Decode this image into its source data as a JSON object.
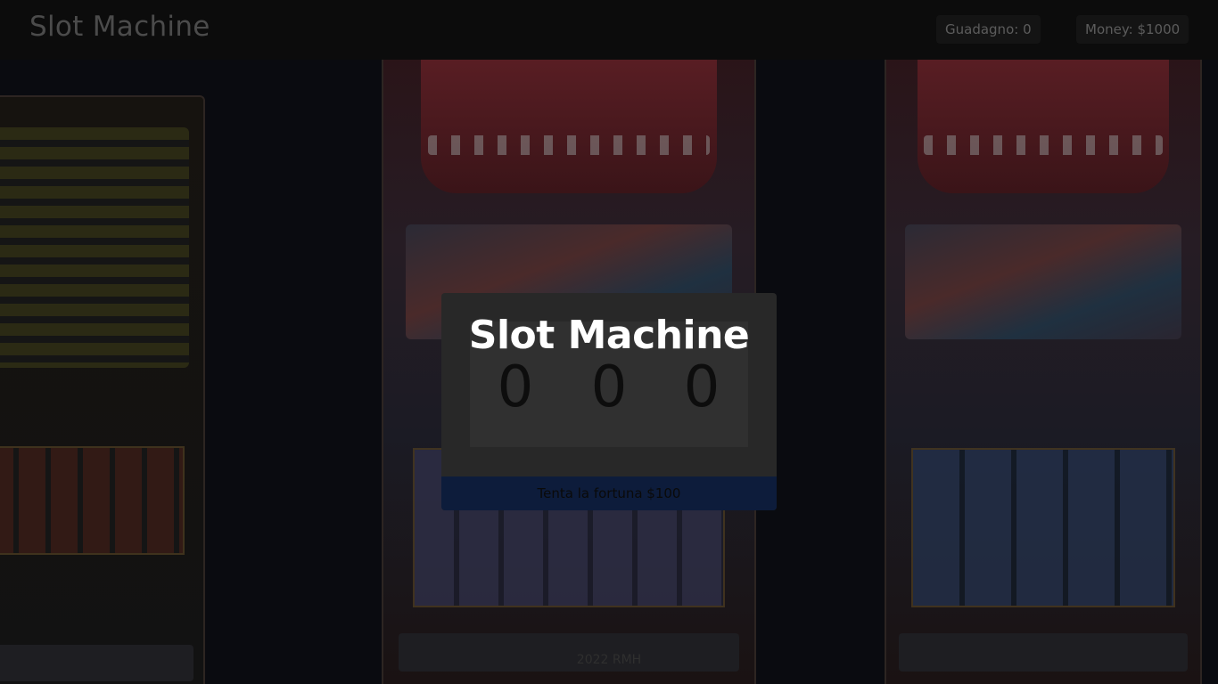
{
  "navbar": {
    "brand": "Slot Machine",
    "gain_label": "Guadagno: 0",
    "money_label": "Money: $1000"
  },
  "modal": {
    "title": "Slot Machine",
    "reels": [
      "0",
      "0",
      "0"
    ],
    "spin_button": "Tenta la fortuna $100"
  },
  "footer": {
    "text": "2022 RMH"
  },
  "colors": {
    "navbar_bg": "#0c0c0c",
    "modal_bg": "#282828",
    "button_bg": "#0d1c3b",
    "title_color": "#ffffff"
  }
}
